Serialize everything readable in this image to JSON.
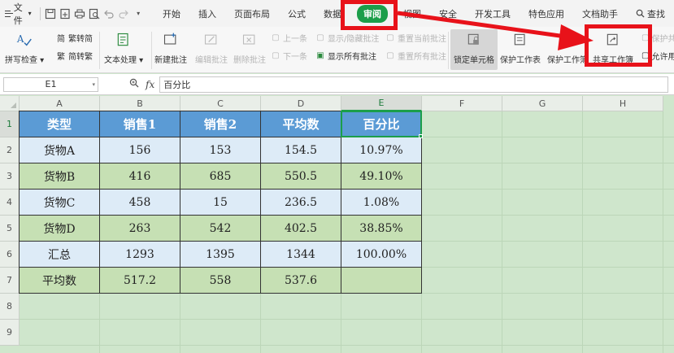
{
  "menubar": {
    "file_label": "文件",
    "tabs": [
      {
        "label": "开始"
      },
      {
        "label": "插入"
      },
      {
        "label": "页面布局"
      },
      {
        "label": "公式"
      },
      {
        "label": "数据"
      },
      {
        "label": "审阅"
      },
      {
        "label": "视图"
      },
      {
        "label": "安全"
      },
      {
        "label": "开发工具"
      },
      {
        "label": "特色应用"
      },
      {
        "label": "文档助手"
      }
    ],
    "search_label": "查找",
    "active_tab": "审阅"
  },
  "ribbon": {
    "spellcheck": "拼写检查",
    "trad_to_simp": "繁转简",
    "simp_to_trad": "简转繁",
    "text_process": "文本处理",
    "new_comment": "新建批注",
    "edit_comment": "编辑批注",
    "delete_comment": "删除批注",
    "prev": "上一条",
    "next": "下一条",
    "show_hide_comment": "显示/隐藏批注",
    "show_all_comments": "显示所有批注",
    "reset_current_comment": "重置当前批注",
    "reset_all_comments": "重置所有批注",
    "lock_cell": "锁定单元格",
    "protect_sheet": "保护工作表",
    "protect_workbook": "保护工作簿",
    "share_workbook": "共享工作簿",
    "protect_share": "保护共享",
    "allow_edit": "允许用户编辑区域"
  },
  "formula_bar": {
    "cell_ref": "E1",
    "fx_label": "fx",
    "content": "百分比"
  },
  "sheet": {
    "columns": [
      "A",
      "B",
      "C",
      "D",
      "E",
      "F",
      "G",
      "H"
    ],
    "rows": [
      "1",
      "2",
      "3",
      "4",
      "5",
      "6",
      "7",
      "8",
      "9"
    ],
    "selected_cell": "E1",
    "table": {
      "header": [
        "类型",
        "销售1",
        "销售2",
        "平均数",
        "百分比"
      ],
      "rows": [
        [
          "货物A",
          "156",
          "153",
          "154.5",
          "10.97%"
        ],
        [
          "货物B",
          "416",
          "685",
          "550.5",
          "49.10%"
        ],
        [
          "货物C",
          "458",
          "15",
          "236.5",
          "1.08%"
        ],
        [
          "货物D",
          "263",
          "542",
          "402.5",
          "38.85%"
        ],
        [
          "汇总",
          "1293",
          "1395",
          "1344",
          "100.00%"
        ],
        [
          "平均数",
          "517.2",
          "558",
          "537.6",
          ""
        ]
      ]
    }
  },
  "colors": {
    "header_fill": "#5b9bd5",
    "row_blue": "#ddebf7",
    "row_green": "#c6e0b4",
    "highlight": "#e8121a",
    "active_tab": "#1c9e4a"
  }
}
